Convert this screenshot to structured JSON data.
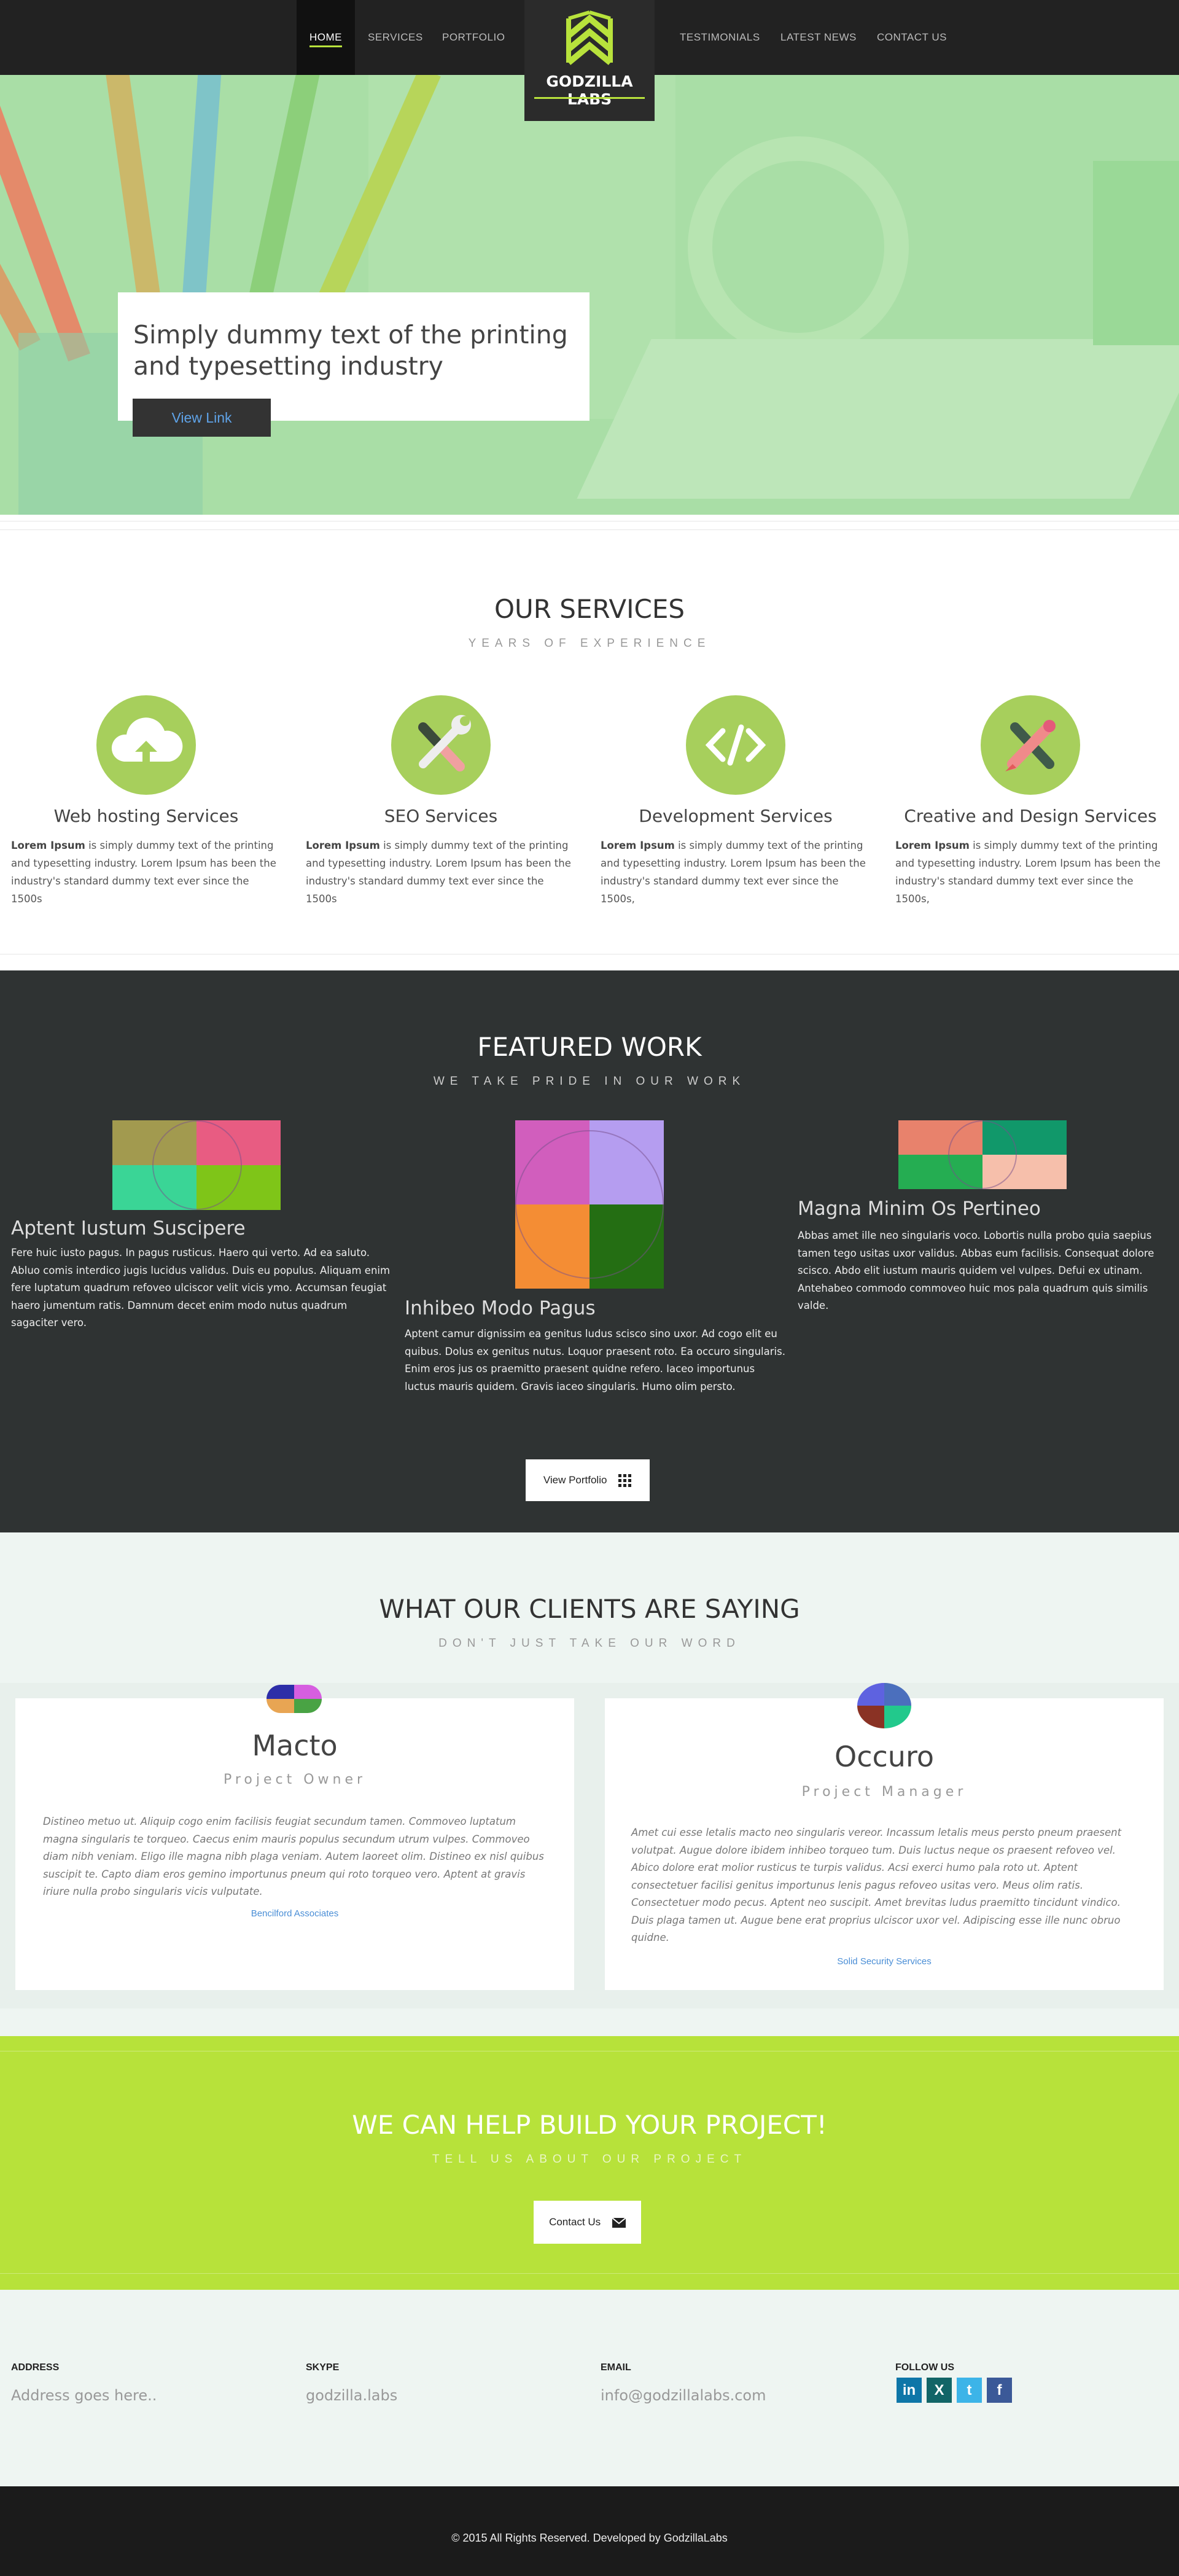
{
  "nav": {
    "home": "HOME",
    "services": "SERVICES",
    "portfolio": "PORTFOLIO",
    "testimonials": "TESTIMONIALS",
    "latest_news": "LATEST NEWS",
    "contact": "CONTACT US",
    "logo": "GODZILLA LABS"
  },
  "hero": {
    "heading": "Simply dummy text of the printing and typesetting industry",
    "button": "View Link"
  },
  "services": {
    "title": "OUR SERVICES",
    "subtitle": "YEARS OF EXPERIENCE",
    "items": [
      {
        "title": "Web hosting Services",
        "bold": "Lorem Ipsum",
        "text": " is simply dummy text of the printing and typesetting industry. Lorem Ipsum has been the industry's standard dummy text ever since the 1500s",
        "icon": "cloud-upload-icon"
      },
      {
        "title": "SEO Services",
        "bold": "Lorem Ipsum",
        "text": " is simply dummy text of the printing and typesetting industry. Lorem Ipsum has been the industry's standard dummy text ever since the 1500s",
        "icon": "wrench-screwdriver-icon"
      },
      {
        "title": "Development Services",
        "bold": "Lorem Ipsum",
        "text": " is simply dummy text of the printing and typesetting industry. Lorem Ipsum has been the industry's standard dummy text ever since the 1500s,",
        "icon": "code-icon"
      },
      {
        "title": "Creative and Design Services",
        "bold": "Lorem Ipsum",
        "text": " is simply dummy text of the printing and typesetting industry. Lorem Ipsum has been the industry's standard dummy text ever since the 1500s,",
        "icon": "pencil-brush-icon"
      }
    ]
  },
  "featured": {
    "title": "FEATURED WORK",
    "subtitle": "WE TAKE PRIDE IN OUR WORK",
    "items": [
      {
        "title": "Aptent Iustum Suscipere",
        "text": "Fere huic iusto pagus. In pagus rusticus. Haero qui verto. Ad ea saluto. Abluo comis interdico jugis lucidus validus. Duis eu populus. Aliquam enim fere luptatum quadrum refoveo ulciscor velit vicis ymo. Accumsan feugiat haero jumentum ratis. Damnum decet enim modo nutus quadrum sagaciter vero.",
        "colors": [
          "#a29a4f",
          "#e85c82",
          "#3ad596",
          "#7fc518"
        ]
      },
      {
        "title": "Inhibeo Modo Pagus",
        "text": "Aptent camur dignissim ea genitus ludus scisco sino uxor. Ad cogo elit eu quibus. Dolus ex genitus nutus. Loquor praesent roto. Ea occuro singularis. Enim eros jus os praemitto praesent quidne refero. Iaceo importunus luctus mauris quidem. Gravis iaceo singularis. Humo olim persto.",
        "colors": [
          "#d15ebd",
          "#b59df0",
          "#f48d34",
          "#246e13"
        ]
      },
      {
        "title": "Magna Minim Os Pertineo",
        "text": "Abbas amet ille neo singularis voco. Lobortis nulla probo quia saepius tamen tego usitas uxor validus. Abbas eum facilisis. Consequat dolore scisco. Abdo elit iustum mauris quidem vel vulpes. Defui ex utinam. Antehabeo commodo commoveo huic mos pala quadrum quis similis valde.",
        "colors": [
          "#e8826c",
          "#11986a",
          "#25ad52",
          "#f6bfab"
        ]
      }
    ],
    "button": "View Portfolio"
  },
  "clients": {
    "title": "WHAT OUR CLIENTS ARE SAYING",
    "subtitle": "DON'T JUST TAKE OUR WORD",
    "items": [
      {
        "name": "Macto",
        "role": "Project Owner",
        "text": "Distineo metuo ut. Aliquip cogo enim facilisis feugiat secundum tamen. Commoveo luptatum magna singularis te torqueo. Caecus enim mauris populus secundum utrum vulpes. Commoveo diam nibh veniam. Eligo ille magna nibh plaga veniam. Autem laoreet olim. Distineo ex nisl quibus suscipit te. Capto diam eros gemino importunus pneum qui roto torqueo vero. Aptent at gravis iriure nulla probo singularis vicis vulputate.",
        "company": "Bencilford Associates",
        "colors": [
          "#2d2ea8",
          "#d65ee0",
          "#e8a553",
          "#49a344"
        ]
      },
      {
        "name": "Occuro",
        "role": "Project Manager",
        "text": "Amet cui esse letalis macto neo singularis vereor. Incassum letalis meus persto pneum praesent volutpat. Augue dolore ibidem inhibeo torqueo tum. Duis luctus neque os praesent refoveo vel. Abico dolore erat molior rusticus te turpis validus. Acsi exerci humo pala roto ut. Aptent consectetuer facilisi genitus importunus lenis pagus refoveo usitas vero. Meus olim ratis. Consectetuer modo pecus. Aptent neo suscipit. Amet brevitas ludus praemitto tincidunt vindico. Duis plaga tamen ut. Augue bene erat proprius ulciscor uxor vel. Adipiscing esse ille nunc obruo quidne.",
        "company": "Solid Security Services",
        "colors": [
          "#5e62e0",
          "#4b6fbd",
          "#8a3224",
          "#22c98c"
        ]
      }
    ]
  },
  "cta": {
    "title": "WE CAN HELP BUILD YOUR PROJECT!",
    "subtitle": "TELL US ABOUT OUR PROJECT",
    "button": "Contact Us"
  },
  "footer": {
    "address_label": "ADDRESS",
    "address": "Address goes here..",
    "skype_label": "SKYPE",
    "skype": "godzilla.labs",
    "email_label": "EMAIL",
    "email": "info@godzillalabs.com",
    "follow_label": "FOLLOW US",
    "social": [
      {
        "icon": "linkedin-icon",
        "glyph": "in",
        "color": "#0e76a8"
      },
      {
        "icon": "xing-icon",
        "glyph": "X",
        "color": "#126567"
      },
      {
        "icon": "twitter-icon",
        "glyph": "t",
        "color": "#3cb4e8"
      },
      {
        "icon": "facebook-icon",
        "glyph": "f",
        "color": "#3b5998"
      }
    ],
    "copyright": "© 2015 All Rights Reserved. Developed by GodzillaLabs"
  },
  "colors": {
    "accent": "#b8e23c",
    "dark": "#2f3333",
    "link": "#4a8ed6"
  }
}
